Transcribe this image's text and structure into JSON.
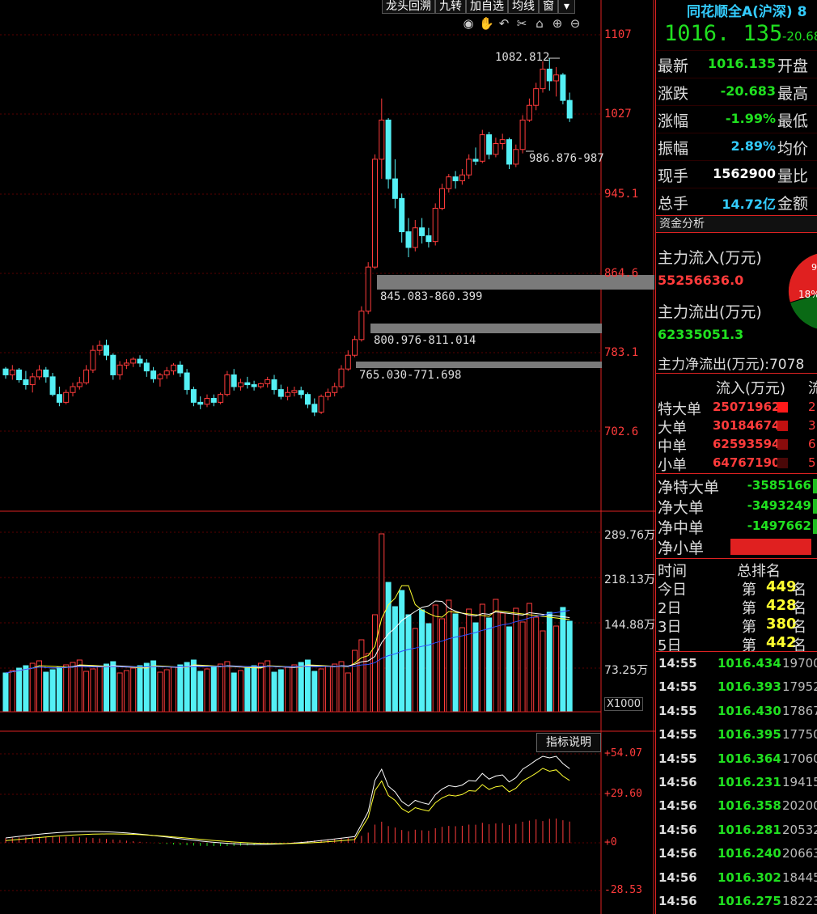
{
  "toolbar": {
    "items": [
      "龙头回溯",
      "九转",
      "加自选",
      "均线",
      "窗"
    ]
  },
  "tools": [
    "eye-icon",
    "hand-icon",
    "undo-icon",
    "scissors-icon",
    "lock-icon",
    "zoom-in-icon",
    "zoom-out-icon"
  ],
  "price_axis": [
    "1107",
    "1027",
    "945.1",
    "864.6",
    "783.1",
    "702.6"
  ],
  "price_annotations": {
    "high": "1082.812",
    "low": "986.876-987"
  },
  "zones": [
    "845.083-860.399",
    "800.976-811.014",
    "765.030-771.698"
  ],
  "volume_axis": [
    "289.76万",
    "218.13万",
    "144.88万",
    "73.25万"
  ],
  "volume_unit": "X1000",
  "indicator_button": "指标说明",
  "macd_axis": [
    "+54.07",
    "+29.60",
    "+0",
    "-28.53"
  ],
  "chart_data": {
    "type": "candlestick",
    "ylim": [
      702.6,
      1107
    ],
    "candles": [
      [
        766,
        768,
        756,
        760
      ],
      [
        760,
        770,
        755,
        765
      ],
      [
        765,
        767,
        752,
        755
      ],
      [
        755,
        764,
        745,
        750
      ],
      [
        750,
        762,
        742,
        758
      ],
      [
        758,
        770,
        755,
        765
      ],
      [
        765,
        768,
        752,
        758
      ],
      [
        758,
        762,
        738,
        740
      ],
      [
        740,
        748,
        728,
        732
      ],
      [
        732,
        745,
        730,
        742
      ],
      [
        742,
        752,
        738,
        748
      ],
      [
        748,
        758,
        745,
        752
      ],
      [
        752,
        770,
        750,
        765
      ],
      [
        765,
        790,
        762,
        785
      ],
      [
        785,
        795,
        780,
        790
      ],
      [
        790,
        796,
        775,
        780
      ],
      [
        780,
        782,
        755,
        760
      ],
      [
        760,
        774,
        755,
        770
      ],
      [
        770,
        776,
        766,
        772
      ],
      [
        772,
        778,
        768,
        776
      ],
      [
        776,
        780,
        768,
        772
      ],
      [
        772,
        776,
        758,
        764
      ],
      [
        764,
        768,
        752,
        756
      ],
      [
        756,
        762,
        748,
        760
      ],
      [
        760,
        768,
        756,
        764
      ],
      [
        764,
        772,
        760,
        770
      ],
      [
        770,
        774,
        758,
        762
      ],
      [
        762,
        766,
        740,
        745
      ],
      [
        745,
        748,
        728,
        732
      ],
      [
        732,
        738,
        725,
        730
      ],
      [
        730,
        740,
        727,
        736
      ],
      [
        736,
        740,
        728,
        732
      ],
      [
        732,
        742,
        730,
        740
      ],
      [
        740,
        764,
        738,
        760
      ],
      [
        760,
        766,
        744,
        748
      ],
      [
        748,
        756,
        744,
        752
      ],
      [
        752,
        758,
        746,
        750
      ],
      [
        750,
        754,
        744,
        748
      ],
      [
        748,
        752,
        746,
        751
      ],
      [
        751,
        758,
        747,
        755
      ],
      [
        755,
        760,
        740,
        745
      ],
      [
        745,
        750,
        735,
        738
      ],
      [
        738,
        748,
        734,
        742
      ],
      [
        742,
        748,
        738,
        744
      ],
      [
        744,
        748,
        736,
        740
      ],
      [
        740,
        742,
        726,
        730
      ],
      [
        730,
        736,
        718,
        722
      ],
      [
        722,
        740,
        720,
        738
      ],
      [
        738,
        746,
        734,
        742
      ],
      [
        742,
        752,
        738,
        748
      ],
      [
        748,
        770,
        746,
        766
      ],
      [
        766,
        785,
        764,
        780
      ],
      [
        780,
        800,
        778,
        796
      ],
      [
        796,
        830,
        794,
        825
      ],
      [
        825,
        875,
        822,
        870
      ],
      [
        870,
        985,
        868,
        980
      ],
      [
        980,
        1042,
        960,
        1020
      ],
      [
        1020,
        1022,
        950,
        960
      ],
      [
        960,
        980,
        930,
        940
      ],
      [
        940,
        945,
        895,
        906
      ],
      [
        906,
        920,
        880,
        890
      ],
      [
        890,
        918,
        886,
        910
      ],
      [
        910,
        920,
        894,
        902
      ],
      [
        902,
        910,
        890,
        896
      ],
      [
        896,
        935,
        892,
        930
      ],
      [
        930,
        955,
        928,
        950
      ],
      [
        950,
        965,
        946,
        962
      ],
      [
        962,
        968,
        950,
        958
      ],
      [
        958,
        970,
        954,
        964
      ],
      [
        964,
        985,
        960,
        980
      ],
      [
        980,
        992,
        974,
        978
      ],
      [
        978,
        1010,
        976,
        1005
      ],
      [
        1005,
        1008,
        980,
        985
      ],
      [
        985,
        1002,
        982,
        996
      ],
      [
        996,
        1006,
        990,
        1000
      ],
      [
        1000,
        1002,
        970,
        975
      ],
      [
        975,
        995,
        972,
        990
      ],
      [
        990,
        1025,
        986,
        1020
      ],
      [
        1020,
        1042,
        1018,
        1035
      ],
      [
        1035,
        1058,
        1030,
        1052
      ],
      [
        1052,
        1080,
        1048,
        1072
      ],
      [
        1072,
        1083,
        1050,
        1060
      ],
      [
        1060,
        1074,
        1044,
        1066
      ],
      [
        1066,
        1068,
        1036,
        1040
      ],
      [
        1040,
        1048,
        1018,
        1022
      ]
    ]
  },
  "panel": {
    "title": "同花顺全A(沪深) 8",
    "price": "1016. 135",
    "change": "-20.68",
    "quote": [
      {
        "label": "最新",
        "value": "1016.135",
        "color": "#20e020",
        "label2": "开盘"
      },
      {
        "label": "涨跌",
        "value": "-20.683",
        "color": "#20e020",
        "label2": "最高"
      },
      {
        "label": "涨幅",
        "value": "-1.99%",
        "color": "#20e020",
        "label2": "最低"
      },
      {
        "label": "振幅",
        "value": "2.89%",
        "color": "#3cf",
        "label2": "均价"
      },
      {
        "label": "现手",
        "value": "1562900",
        "color": "#fff",
        "label2": "量比"
      },
      {
        "label": "总手",
        "value": "14.72亿",
        "color": "#3cf",
        "label2": "金额"
      }
    ],
    "fund_header": "资金分析",
    "inflow_label": "主力流入(万元)",
    "inflow_value": "55256636.0",
    "outflow_label": "主力流出(万元)",
    "outflow_value": "62335051.3",
    "pie_pct": "18%",
    "pie_small": "9",
    "net_label": "主力净流出(万元):7078",
    "col_in": "流入(万元)",
    "col_out": "流",
    "orders": [
      {
        "label": "特大单",
        "value": "25071962",
        "c2": "2",
        "color": "#ff1a1a"
      },
      {
        "label": "大单",
        "value": "30184674",
        "c2": "3",
        "color": "#c01010"
      },
      {
        "label": "中单",
        "value": "62593594",
        "c2": "6",
        "color": "#8a0c0c"
      },
      {
        "label": "小单",
        "value": "64767190",
        "c2": "5",
        "color": "#4a0808"
      }
    ],
    "nets": [
      {
        "label": "净特大单",
        "value": "-3585166"
      },
      {
        "label": "净大单",
        "value": "-3493249"
      },
      {
        "label": "净中单",
        "value": "-1497662"
      },
      {
        "label": "净小单",
        "value": ""
      }
    ],
    "rank_head": {
      "time": "时间",
      "rank": "总排名"
    },
    "ranks": [
      {
        "day": "今日",
        "num": "449"
      },
      {
        "day": "2日",
        "num": "428"
      },
      {
        "day": "3日",
        "num": "380"
      },
      {
        "day": "5日",
        "num": "442"
      }
    ],
    "rank_di": "第",
    "rank_ming": "名",
    "ticks": [
      {
        "t": "14:55",
        "p": "1016.434",
        "v": "19700"
      },
      {
        "t": "14:55",
        "p": "1016.393",
        "v": "17952"
      },
      {
        "t": "14:55",
        "p": "1016.430",
        "v": "17867"
      },
      {
        "t": "14:55",
        "p": "1016.395",
        "v": "17750"
      },
      {
        "t": "14:55",
        "p": "1016.364",
        "v": "17060"
      },
      {
        "t": "14:56",
        "p": "1016.231",
        "v": "19415"
      },
      {
        "t": "14:56",
        "p": "1016.358",
        "v": "20200"
      },
      {
        "t": "14:56",
        "p": "1016.281",
        "v": "20532"
      },
      {
        "t": "14:56",
        "p": "1016.240",
        "v": "20663"
      },
      {
        "t": "14:56",
        "p": "1016.302",
        "v": "18445"
      },
      {
        "t": "14:56",
        "p": "1016.275",
        "v": "18223"
      }
    ]
  }
}
